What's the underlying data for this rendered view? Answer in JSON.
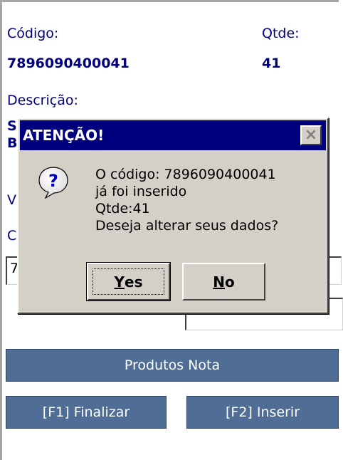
{
  "form": {
    "codigo_label": "Código:",
    "qtde_label": "Qtde:",
    "codigo_value": "7896090400041",
    "qtde_value": "41",
    "descricao_label": "Descrição:",
    "desc_partial_1": "S",
    "desc_partial_2": "B",
    "side_letter_v": "V",
    "side_letter_c": "C",
    "field_partial": "7"
  },
  "buttons": {
    "produtos_nota": "Produtos Nota",
    "finalizar": "[F1] Finalizar",
    "inserir": "[F2] Inserir"
  },
  "dialog": {
    "title": "ATENÇÃO!",
    "close_symbol": "×",
    "icon": "question-icon",
    "message_lines": [
      "O código: 7896090400041",
      "já foi inserido",
      "Qtde:41",
      "Deseja alterar seus dados?"
    ],
    "yes_first": "Y",
    "yes_rest": "es",
    "no_first": "N",
    "no_rest": "o"
  },
  "colors": {
    "label_blue": "#00007f",
    "button_bg": "#506d96",
    "dialog_bg": "#d4d0c8",
    "titlebar_bg": "#00007f"
  }
}
